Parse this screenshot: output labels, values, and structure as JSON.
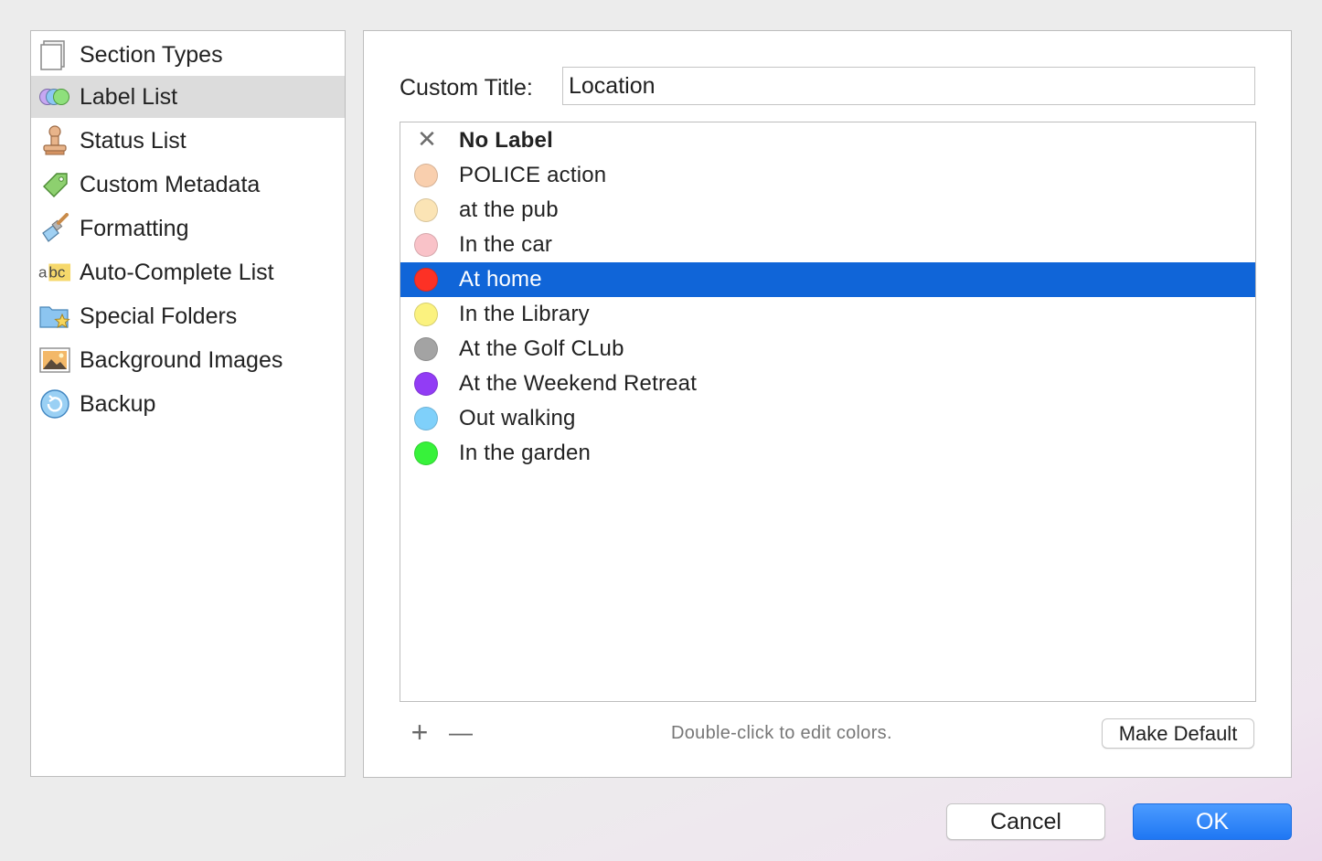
{
  "sidebar": {
    "items": [
      {
        "label": "Section Types",
        "icon": "pages-icon",
        "selected": false
      },
      {
        "label": "Label List",
        "icon": "label-circles-icon",
        "selected": true
      },
      {
        "label": "Status List",
        "icon": "stamp-icon",
        "selected": false
      },
      {
        "label": "Custom Metadata",
        "icon": "tag-icon",
        "selected": false
      },
      {
        "label": "Formatting",
        "icon": "paintbrush-icon",
        "selected": false
      },
      {
        "label": "Auto-Complete List",
        "icon": "abc-icon",
        "selected": false
      },
      {
        "label": "Special Folders",
        "icon": "folder-star-icon",
        "selected": false
      },
      {
        "label": "Background Images",
        "icon": "picture-icon",
        "selected": false
      },
      {
        "label": "Backup",
        "icon": "backup-icon",
        "selected": false
      }
    ]
  },
  "panel": {
    "custom_title_label": "Custom Title:",
    "custom_title_value": "Location",
    "labels": [
      {
        "name": "No Label",
        "color": null,
        "bold": true
      },
      {
        "name": "POLICE action",
        "color": "#f9cfae"
      },
      {
        "name": "at the pub",
        "color": "#fbe4b5"
      },
      {
        "name": "In the car",
        "color": "#f9c2c8"
      },
      {
        "name": "At home",
        "color": "#fd3125",
        "selected": true
      },
      {
        "name": "In the Library",
        "color": "#fbf27f"
      },
      {
        "name": "At the Golf CLub",
        "color": "#a3a3a3"
      },
      {
        "name": "At the Weekend Retreat",
        "color": "#923cf5"
      },
      {
        "name": "Out walking",
        "color": "#7fd0fa"
      },
      {
        "name": "In the garden",
        "color": "#37f23a"
      }
    ],
    "add_symbol": "+",
    "remove_symbol": "—",
    "hint": "Double-click to edit colors.",
    "make_default_label": "Make Default"
  },
  "footer": {
    "cancel_label": "Cancel",
    "ok_label": "OK"
  },
  "colors": {
    "selection_blue": "#1065d8",
    "ok_button": "#2a82f6"
  }
}
